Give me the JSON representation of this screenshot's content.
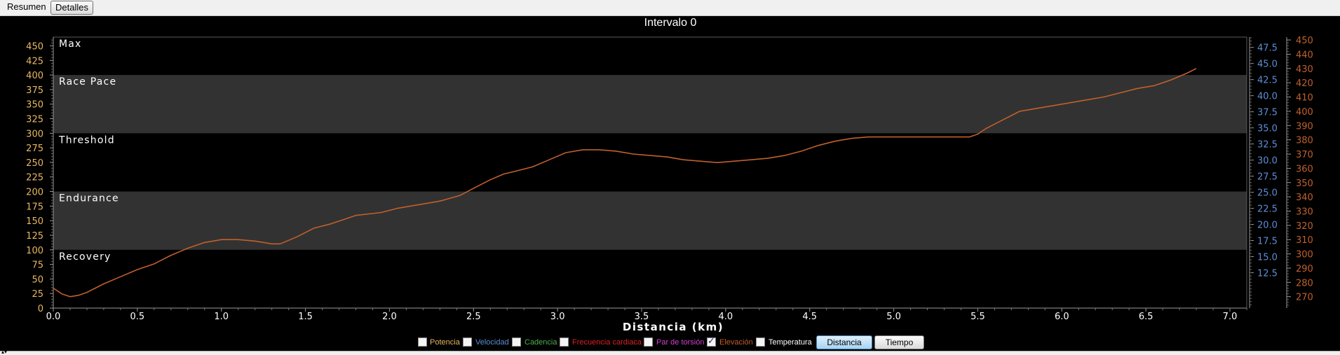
{
  "tabs": [
    {
      "label": "Resumen",
      "active": false
    },
    {
      "label": "Detalles",
      "active": true
    }
  ],
  "legend": {
    "items": [
      {
        "label": "Potencia",
        "color": "#e8b860",
        "checked": false
      },
      {
        "label": "Velocidad",
        "color": "#5b8fd6",
        "checked": false
      },
      {
        "label": "Cadencia",
        "color": "#4caf50",
        "checked": false
      },
      {
        "label": "Frecuencia cardiaca",
        "color": "#e02020",
        "checked": false
      },
      {
        "label": "Par de torsión",
        "color": "#d040d0",
        "checked": false
      },
      {
        "label": "Elevación",
        "color": "#c0602c",
        "checked": true
      },
      {
        "label": "Temperatura",
        "color": "#ffffff",
        "checked": false
      }
    ],
    "buttons": [
      {
        "label": "Distancia",
        "selected": true
      },
      {
        "label": "Tiempo",
        "selected": false
      }
    ]
  },
  "chart_data": {
    "type": "line",
    "title": "Intervalo 0",
    "xlabel": "Distancia (km)",
    "xlim": [
      0,
      7.1
    ],
    "xticks": [
      0,
      0.5,
      1,
      1.5,
      2,
      2.5,
      3,
      3.5,
      4,
      4.5,
      5,
      5.5,
      6,
      6.5,
      7
    ],
    "xtick_labels": [
      "0.0",
      "0.5",
      "1.0",
      "1.5",
      "2.0",
      "2.5",
      "3.0",
      "3.5",
      "4.0",
      "4.5",
      "5.0",
      "5.5",
      "6.0",
      "6.5",
      "7.0"
    ],
    "y_left": {
      "lim": [
        0,
        465
      ],
      "ticks": [
        0,
        25,
        50,
        75,
        100,
        125,
        150,
        175,
        200,
        225,
        250,
        275,
        300,
        325,
        350,
        375,
        400,
        425,
        450
      ],
      "color": "#e8b860"
    },
    "y_mid": {
      "lim": [
        7.0,
        49.1
      ],
      "tick_labels": [
        "12.5",
        "15.0",
        "17.5",
        "20.0",
        "22.5",
        "25.0",
        "27.5",
        "30.0",
        "32.5",
        "35.0",
        "37.5",
        "40.0",
        "42.5",
        "45.0",
        "47.5"
      ],
      "color": "#5b8fd6"
    },
    "y_right": {
      "lim": [
        262,
        452
      ],
      "ticks": [
        270,
        280,
        290,
        300,
        310,
        320,
        330,
        340,
        350,
        360,
        370,
        380,
        390,
        400,
        410,
        420,
        430,
        440,
        450
      ],
      "color": "#c0602c"
    },
    "zones": [
      {
        "name": "Recovery",
        "from": 0,
        "to": 100,
        "shaded": false
      },
      {
        "name": "Endurance",
        "from": 100,
        "to": 200,
        "shaded": true
      },
      {
        "name": "Threshold",
        "from": 200,
        "to": 300,
        "shaded": false
      },
      {
        "name": "Race Pace",
        "from": 300,
        "to": 400,
        "shaded": true
      },
      {
        "name": "Max",
        "from": 400,
        "to": 465,
        "shaded": false
      }
    ],
    "series": [
      {
        "name": "Elevación",
        "color": "#c0602c",
        "axis": "right",
        "x": [
          0.0,
          0.05,
          0.1,
          0.15,
          0.2,
          0.25,
          0.3,
          0.4,
          0.5,
          0.6,
          0.65,
          0.7,
          0.8,
          0.9,
          0.95,
          1.0,
          1.1,
          1.2,
          1.3,
          1.35,
          1.45,
          1.55,
          1.65,
          1.75,
          1.8,
          1.95,
          2.05,
          2.15,
          2.3,
          2.42,
          2.5,
          2.6,
          2.68,
          2.75,
          2.85,
          2.95,
          3.05,
          3.15,
          3.25,
          3.35,
          3.45,
          3.55,
          3.65,
          3.75,
          3.85,
          3.95,
          4.05,
          4.15,
          4.25,
          4.35,
          4.45,
          4.55,
          4.65,
          4.75,
          4.85,
          4.95,
          5.05,
          5.15,
          5.25,
          5.35,
          5.45,
          5.5,
          5.55,
          5.65,
          5.75,
          5.85,
          5.95,
          6.05,
          6.15,
          6.25,
          6.35,
          6.45,
          6.55,
          6.65,
          6.75,
          6.8
        ],
        "values": [
          276,
          272,
          270,
          271,
          273,
          276,
          279,
          284,
          289,
          293,
          296,
          299,
          304,
          308,
          309,
          310,
          310,
          309,
          307,
          307,
          312,
          318,
          321,
          325,
          327,
          329,
          332,
          334,
          337,
          341,
          346,
          352,
          356,
          358,
          361,
          366,
          371,
          373,
          373,
          372,
          370,
          369,
          368,
          366,
          365,
          364,
          365,
          366,
          367,
          369,
          372,
          376,
          379,
          381,
          382,
          382,
          382,
          382,
          382,
          382,
          382,
          384,
          388,
          394,
          400,
          402,
          404,
          406,
          408,
          410,
          413,
          416,
          418,
          422,
          427,
          430
        ]
      }
    ]
  }
}
